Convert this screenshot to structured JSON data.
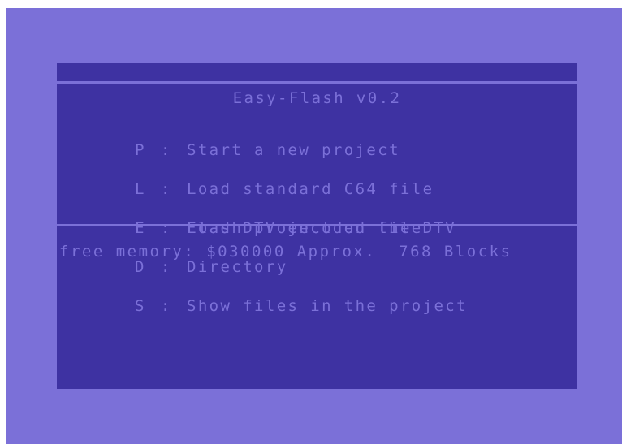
{
  "app": {
    "title": "Easy-Flash v0.2"
  },
  "menu": {
    "separator": ":",
    "items": [
      {
        "key": "P",
        "label": "Start a new project"
      },
      {
        "key": "L",
        "label": "Load standard C64 file"
      },
      {
        "key": "E",
        "label": "Load DTV encoded file"
      },
      {
        "key": "D",
        "label": "Directory"
      },
      {
        "key": "S",
        "label": "Show files in the project"
      }
    ],
    "flash": {
      "key": "F",
      "label": "Flash project on the DTV"
    }
  },
  "status": {
    "memory_text": "free memory: $030000 Approx.  768 Blocks"
  },
  "colors": {
    "border": "#7b70d8",
    "screen": "#3e32a2",
    "text": "#7b70d8"
  }
}
